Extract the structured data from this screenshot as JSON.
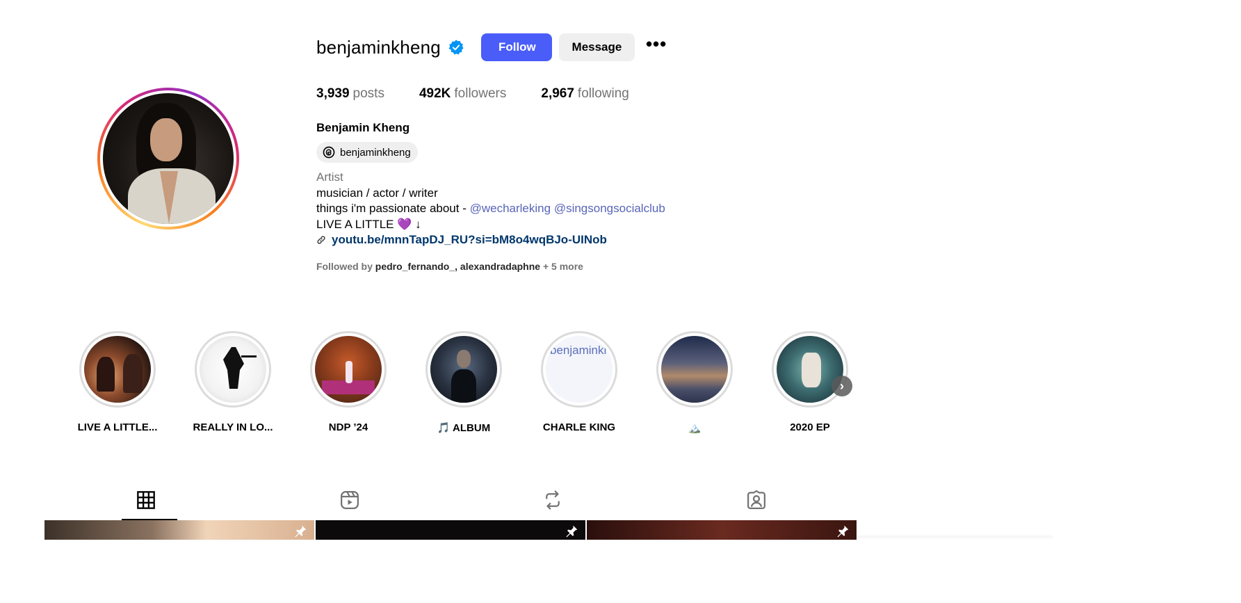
{
  "profile": {
    "username": "benjaminkheng",
    "verified": true,
    "follow_label": "Follow",
    "message_label": "Message",
    "more_label": "•••",
    "stats": [
      {
        "value": "3,939",
        "label": "posts"
      },
      {
        "value": "492K",
        "label": "followers"
      },
      {
        "value": "2,967",
        "label": "following"
      }
    ],
    "full_name": "Benjamin Kheng",
    "threads_handle": "benjaminkheng",
    "category": "Artist",
    "bio_line1": "musician / actor / writer",
    "bio_line2_prefix": "things i'm passionate about - ",
    "bio_mentions": [
      "@wecharleking",
      "@singsongsocialclub"
    ],
    "bio_line3": "LIVE A LITTLE 💜 ↓",
    "link": "youtu.be/mnnTapDJ_RU?si=bM8o4wqBJo-UINob",
    "followed_by_prefix": "Followed by ",
    "followed_by_names": "pedro_fernando_, alexandradaphne",
    "followed_by_more": " + 5 more"
  },
  "highlights": [
    {
      "label": "LIVE A LITTLE..."
    },
    {
      "label": "REALLY IN LO..."
    },
    {
      "label": "NDP ’24"
    },
    {
      "label": "🎵 ALBUM"
    },
    {
      "label": "CHARLE KING",
      "alt_text": "benjaminkheng's highlight story picture"
    },
    {
      "label": "🏔️"
    },
    {
      "label": "2020 EP"
    }
  ],
  "tabs": [
    {
      "icon": "grid-icon",
      "active": true
    },
    {
      "icon": "reels-icon",
      "active": false
    },
    {
      "icon": "reposts-icon",
      "active": false
    },
    {
      "icon": "tagged-icon",
      "active": false
    }
  ],
  "colors": {
    "follow_button": "#4a5df9",
    "verified_badge": "#0095f6",
    "mention": "#5865b8",
    "link": "#00376b",
    "secondary_text": "#737373"
  }
}
